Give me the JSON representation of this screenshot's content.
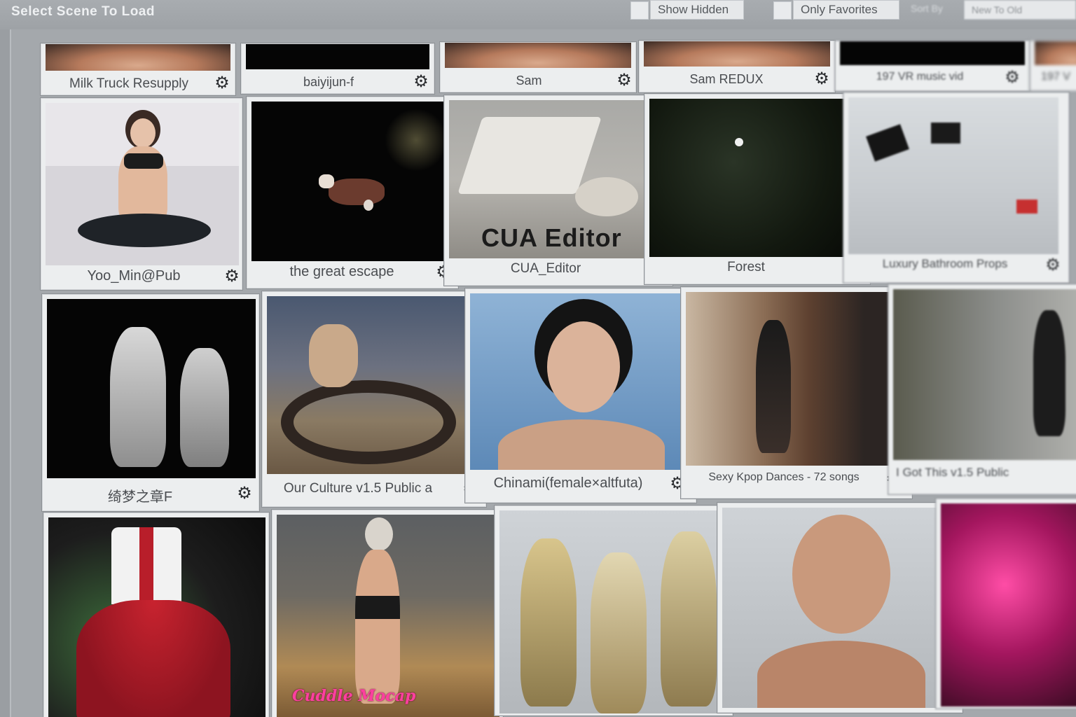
{
  "header": {
    "title": "Select Scene To Load",
    "show_hidden_label": "Show Hidden",
    "only_favorites_label": "Only Favorites",
    "sort_by_label": "Sort By",
    "sort_value": "New To Old"
  },
  "rows": [
    {
      "items": [
        {
          "title": "Milk Truck Resupply",
          "icon": "gear-icon"
        },
        {
          "title": "baiyijun-f",
          "icon": "gear-icon"
        },
        {
          "title": "Sam",
          "icon": "gear-icon"
        },
        {
          "title": "Sam REDUX",
          "icon": "gear-icon"
        },
        {
          "title": "197 VR music vid",
          "icon": "gear-icon"
        },
        {
          "title": "197 V",
          "icon": "gear-icon"
        }
      ]
    },
    {
      "items": [
        {
          "title": "Yoo_Min@Pub",
          "icon": "gear-icon"
        },
        {
          "title": "the great escape",
          "icon": "gear-icon"
        },
        {
          "title": "CUA_Editor",
          "icon": "gear-icon",
          "overlay_text": "CUA Editor"
        },
        {
          "title": "Forest",
          "icon": "gear-icon"
        },
        {
          "title": "Luxury Bathroom Props",
          "icon": "gear-icon"
        }
      ]
    },
    {
      "items": [
        {
          "title": "绮梦之章F",
          "icon": "gear-icon"
        },
        {
          "title": "Our Culture v1.5 Public a",
          "icon": "gear-icon"
        },
        {
          "title": "Chinami(female×altfuta)",
          "icon": "gear-icon"
        },
        {
          "title": "Sexy Kpop Dances - 72 songs",
          "icon": "gear-icon"
        },
        {
          "title": "I Got This v1.5 Public",
          "icon": "gear-icon"
        }
      ]
    },
    {
      "items": [
        {
          "title": "",
          "icon": "gear-icon"
        },
        {
          "title": "",
          "icon": "gear-icon",
          "overlay_text": "Cuddle Mocap"
        },
        {
          "title": "",
          "icon": "gear-icon"
        },
        {
          "title": "",
          "icon": "gear-icon"
        },
        {
          "title": "",
          "icon": "gear-icon"
        }
      ]
    }
  ]
}
